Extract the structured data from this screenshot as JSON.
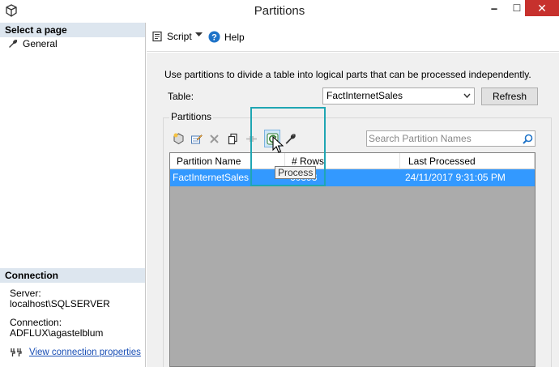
{
  "window": {
    "title": "Partitions",
    "minimize_glyph": "🗕",
    "maximize_glyph": "☐",
    "close_glyph": "✕"
  },
  "sidebar": {
    "select_page_header": "Select a page",
    "items": [
      {
        "label": "General",
        "icon": "wrench-icon"
      }
    ],
    "connection_header": "Connection",
    "server_label": "Server:",
    "server_value": "localhost\\SQLSERVER",
    "connection_label": "Connection:",
    "connection_value": "ADFLUX\\agastelblum",
    "view_connection_link": "View connection properties"
  },
  "toolbar": {
    "script_label": "Script",
    "help_label": "Help"
  },
  "main": {
    "description": "Use partitions to divide a table into logical parts that can be processed independently.",
    "table_label": "Table:",
    "table_selected": "FactInternetSales",
    "refresh_label": "Refresh",
    "partitions_group_label": "Partitions",
    "search_placeholder": "Search Partition Names",
    "grid": {
      "columns": [
        "Partition Name",
        "# Rows",
        "Last Processed"
      ],
      "rows": [
        {
          "name": "FactInternetSales",
          "rows": "60398",
          "last_processed": "24/11/2017 9:31:05 PM",
          "selected": true
        }
      ]
    },
    "tooltip": "Process"
  },
  "colors": {
    "accent_selection": "#3399ff",
    "highlight_box": "#1fa6b3",
    "close_button": "#c7312d",
    "grid_background": "#ababab"
  }
}
